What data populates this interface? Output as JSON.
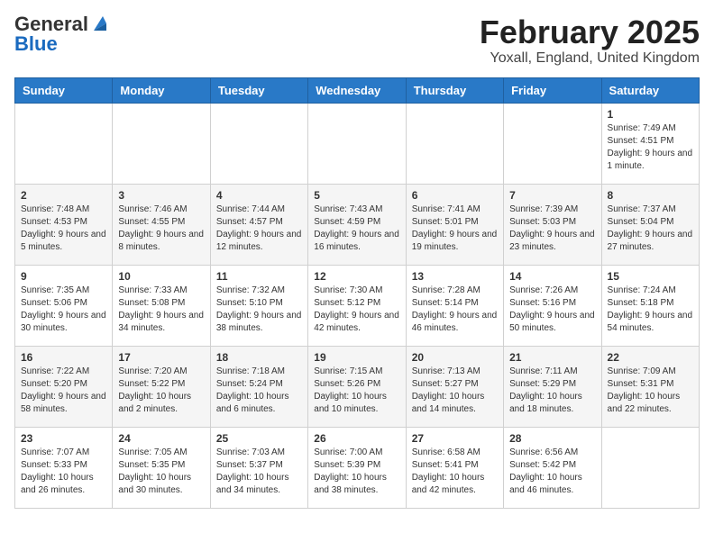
{
  "header": {
    "logo_general": "General",
    "logo_blue": "Blue",
    "month_title": "February 2025",
    "location": "Yoxall, England, United Kingdom"
  },
  "days_of_week": [
    "Sunday",
    "Monday",
    "Tuesday",
    "Wednesday",
    "Thursday",
    "Friday",
    "Saturday"
  ],
  "weeks": [
    [
      {
        "day": "",
        "info": ""
      },
      {
        "day": "",
        "info": ""
      },
      {
        "day": "",
        "info": ""
      },
      {
        "day": "",
        "info": ""
      },
      {
        "day": "",
        "info": ""
      },
      {
        "day": "",
        "info": ""
      },
      {
        "day": "1",
        "info": "Sunrise: 7:49 AM\nSunset: 4:51 PM\nDaylight: 9 hours and 1 minute."
      }
    ],
    [
      {
        "day": "2",
        "info": "Sunrise: 7:48 AM\nSunset: 4:53 PM\nDaylight: 9 hours and 5 minutes."
      },
      {
        "day": "3",
        "info": "Sunrise: 7:46 AM\nSunset: 4:55 PM\nDaylight: 9 hours and 8 minutes."
      },
      {
        "day": "4",
        "info": "Sunrise: 7:44 AM\nSunset: 4:57 PM\nDaylight: 9 hours and 12 minutes."
      },
      {
        "day": "5",
        "info": "Sunrise: 7:43 AM\nSunset: 4:59 PM\nDaylight: 9 hours and 16 minutes."
      },
      {
        "day": "6",
        "info": "Sunrise: 7:41 AM\nSunset: 5:01 PM\nDaylight: 9 hours and 19 minutes."
      },
      {
        "day": "7",
        "info": "Sunrise: 7:39 AM\nSunset: 5:03 PM\nDaylight: 9 hours and 23 minutes."
      },
      {
        "day": "8",
        "info": "Sunrise: 7:37 AM\nSunset: 5:04 PM\nDaylight: 9 hours and 27 minutes."
      }
    ],
    [
      {
        "day": "9",
        "info": "Sunrise: 7:35 AM\nSunset: 5:06 PM\nDaylight: 9 hours and 30 minutes."
      },
      {
        "day": "10",
        "info": "Sunrise: 7:33 AM\nSunset: 5:08 PM\nDaylight: 9 hours and 34 minutes."
      },
      {
        "day": "11",
        "info": "Sunrise: 7:32 AM\nSunset: 5:10 PM\nDaylight: 9 hours and 38 minutes."
      },
      {
        "day": "12",
        "info": "Sunrise: 7:30 AM\nSunset: 5:12 PM\nDaylight: 9 hours and 42 minutes."
      },
      {
        "day": "13",
        "info": "Sunrise: 7:28 AM\nSunset: 5:14 PM\nDaylight: 9 hours and 46 minutes."
      },
      {
        "day": "14",
        "info": "Sunrise: 7:26 AM\nSunset: 5:16 PM\nDaylight: 9 hours and 50 minutes."
      },
      {
        "day": "15",
        "info": "Sunrise: 7:24 AM\nSunset: 5:18 PM\nDaylight: 9 hours and 54 minutes."
      }
    ],
    [
      {
        "day": "16",
        "info": "Sunrise: 7:22 AM\nSunset: 5:20 PM\nDaylight: 9 hours and 58 minutes."
      },
      {
        "day": "17",
        "info": "Sunrise: 7:20 AM\nSunset: 5:22 PM\nDaylight: 10 hours and 2 minutes."
      },
      {
        "day": "18",
        "info": "Sunrise: 7:18 AM\nSunset: 5:24 PM\nDaylight: 10 hours and 6 minutes."
      },
      {
        "day": "19",
        "info": "Sunrise: 7:15 AM\nSunset: 5:26 PM\nDaylight: 10 hours and 10 minutes."
      },
      {
        "day": "20",
        "info": "Sunrise: 7:13 AM\nSunset: 5:27 PM\nDaylight: 10 hours and 14 minutes."
      },
      {
        "day": "21",
        "info": "Sunrise: 7:11 AM\nSunset: 5:29 PM\nDaylight: 10 hours and 18 minutes."
      },
      {
        "day": "22",
        "info": "Sunrise: 7:09 AM\nSunset: 5:31 PM\nDaylight: 10 hours and 22 minutes."
      }
    ],
    [
      {
        "day": "23",
        "info": "Sunrise: 7:07 AM\nSunset: 5:33 PM\nDaylight: 10 hours and 26 minutes."
      },
      {
        "day": "24",
        "info": "Sunrise: 7:05 AM\nSunset: 5:35 PM\nDaylight: 10 hours and 30 minutes."
      },
      {
        "day": "25",
        "info": "Sunrise: 7:03 AM\nSunset: 5:37 PM\nDaylight: 10 hours and 34 minutes."
      },
      {
        "day": "26",
        "info": "Sunrise: 7:00 AM\nSunset: 5:39 PM\nDaylight: 10 hours and 38 minutes."
      },
      {
        "day": "27",
        "info": "Sunrise: 6:58 AM\nSunset: 5:41 PM\nDaylight: 10 hours and 42 minutes."
      },
      {
        "day": "28",
        "info": "Sunrise: 6:56 AM\nSunset: 5:42 PM\nDaylight: 10 hours and 46 minutes."
      },
      {
        "day": "",
        "info": ""
      }
    ]
  ]
}
